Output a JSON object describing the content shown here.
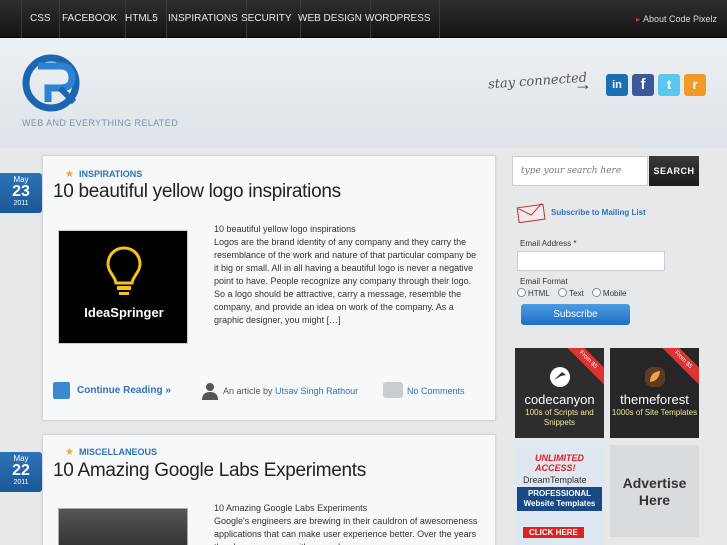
{
  "nav": {
    "items": [
      "CSS",
      "FACEBOOK",
      "HTML5",
      "INSPIRATIONS",
      "SECURITY",
      "WEB DESIGN",
      "WORDPRESS"
    ],
    "about": "About Code Pixelz"
  },
  "header": {
    "tagline": "WEB AND EVERYTHING RELATED",
    "stay_connected": "stay connected",
    "social": {
      "linkedin": "in",
      "facebook": "f",
      "twitter": "t",
      "rss": "r"
    }
  },
  "posts": [
    {
      "month": "May",
      "day": "23",
      "year": "2011",
      "category": "INSPIRATIONS",
      "title": "10 beautiful yellow logo inspirations",
      "thumb_text": "IdeaSpringer",
      "excerpt_title": "10 beautiful yellow logo inspirations",
      "excerpt": "Logos are the brand identity of any company and they carry the resemblance of the work and nature of that particular company be it big or small. All in all having a beautiful logo is never a negative point to have. People recognize any company through their logo. So a logo should be attractive, carry a message, resemble the company, and provide an idea on work of the company. As  a graphic designer, you might […]",
      "continue": "Continue Reading »",
      "author_prefix": "An article by",
      "author": "Utsav Singh Rathour",
      "comments": "No Comments"
    },
    {
      "month": "May",
      "day": "22",
      "year": "2011",
      "category": "MISCELLANEOUS",
      "title": "10 Amazing Google Labs Experiments",
      "excerpt_title": "10 Amazing Google Labs Experiments",
      "excerpt": "Google's engineers are brewing in their cauldron of awesomeness applications that can make user experience better. Over the years they have come up with several"
    }
  ],
  "sidebar": {
    "search_placeholder": "type your search here",
    "search_button": "SEARCH",
    "mailing": "Subscribe to Mailing List",
    "email_label": "Email Address *",
    "format_label": "Email Format",
    "formats": [
      "HTML",
      "Text",
      "Mobile"
    ],
    "subscribe": "Subscribe",
    "ads": [
      {
        "ribbon": "From $5",
        "brand": "codecanyon",
        "sub": "100s of Scripts and Snippets"
      },
      {
        "ribbon": "From $5",
        "brand": "themeforest",
        "sub": "1000s of Site Templates"
      },
      {
        "l1": "UNLIMITED ACCESS!",
        "l2": "DreamTemplate",
        "l3": "PROFESSIONAL Website Templates",
        "l4": "CLICK HERE"
      },
      {
        "text": "Advertise Here"
      }
    ]
  },
  "colors": {
    "accent": "#2d73b8",
    "nav_bg": "#1e1e1e",
    "star": "#f2a317"
  }
}
